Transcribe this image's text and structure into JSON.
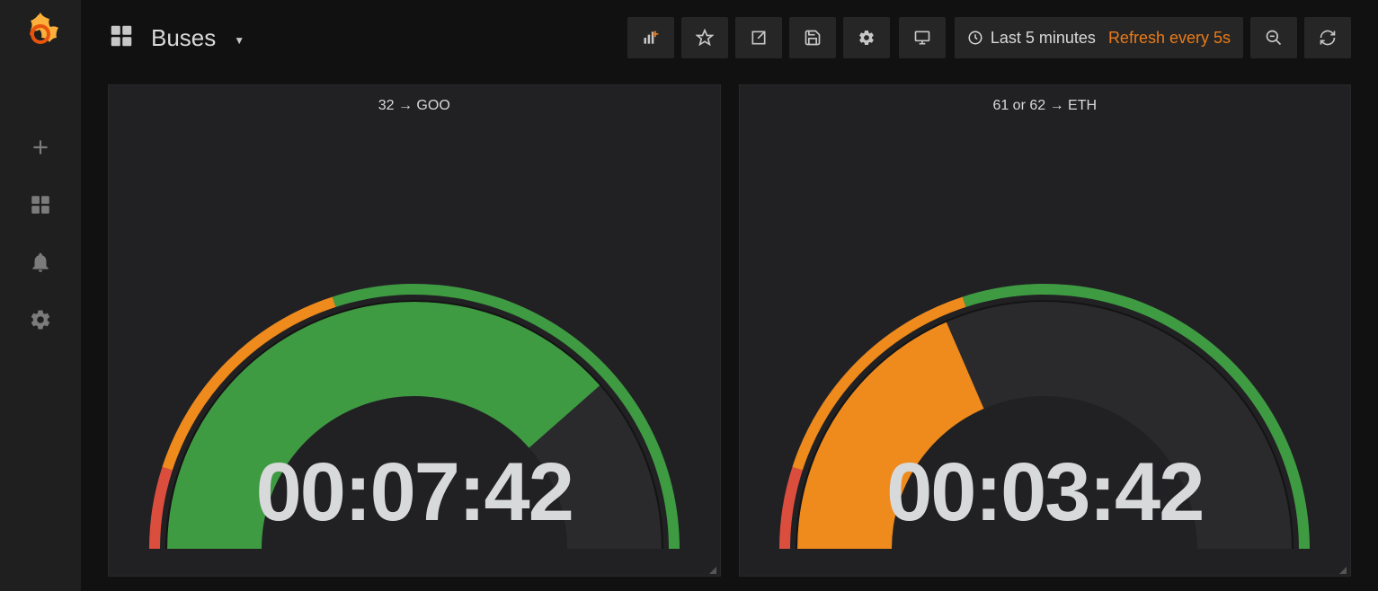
{
  "dashboard": {
    "title": "Buses"
  },
  "toolbar": {
    "time_label": "Last 5 minutes",
    "refresh_label": "Refresh every 5s"
  },
  "colors": {
    "green": "#3f9b42",
    "orange": "#ef8a1c",
    "red": "#db4e3e",
    "value_text": "#d8d9da",
    "panel_bg": "#212124"
  },
  "panels": [
    {
      "title": "32 → GOO",
      "value_display": "00:07:42",
      "value_seconds": 462,
      "max_seconds": 600,
      "fraction": 0.77,
      "fill_color": "#3f9b42",
      "thresholds": [
        {
          "from": 0.0,
          "to": 0.1,
          "color": "#db4e3e"
        },
        {
          "from": 0.1,
          "to": 0.4,
          "color": "#ef8a1c"
        },
        {
          "from": 0.4,
          "to": 1.0,
          "color": "#3f9b42"
        }
      ]
    },
    {
      "title": "61 or 62 → ETH",
      "value_display": "00:03:42",
      "value_seconds": 222,
      "max_seconds": 600,
      "fraction": 0.37,
      "fill_color": "#ef8a1c",
      "thresholds": [
        {
          "from": 0.0,
          "to": 0.1,
          "color": "#db4e3e"
        },
        {
          "from": 0.1,
          "to": 0.4,
          "color": "#ef8a1c"
        },
        {
          "from": 0.4,
          "to": 1.0,
          "color": "#3f9b42"
        }
      ]
    }
  ],
  "chart_data": [
    {
      "type": "gauge",
      "title": "32 → GOO",
      "value": 462,
      "value_formatted": "00:07:42",
      "min": 0,
      "max": 600,
      "unit": "seconds",
      "thresholds": {
        "red_end": 60,
        "orange_end": 240
      }
    },
    {
      "type": "gauge",
      "title": "61 or 62 → ETH",
      "value": 222,
      "value_formatted": "00:03:42",
      "min": 0,
      "max": 600,
      "unit": "seconds",
      "thresholds": {
        "red_end": 60,
        "orange_end": 240
      }
    }
  ]
}
